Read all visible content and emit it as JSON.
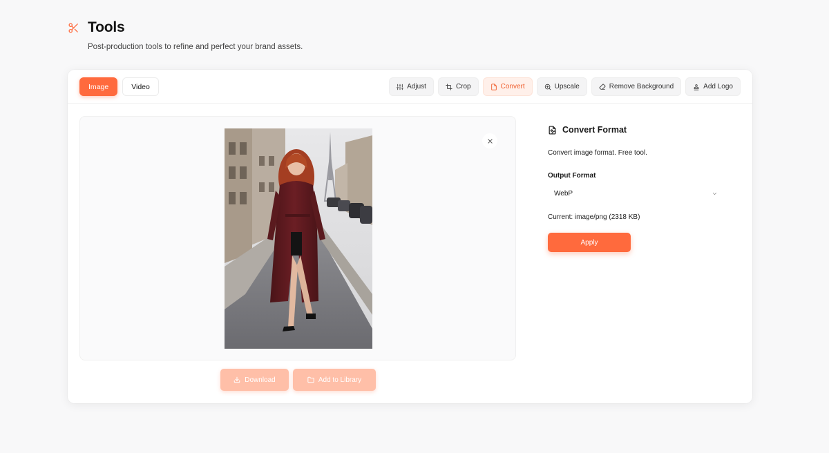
{
  "header": {
    "title": "Tools",
    "subtitle": "Post-production tools to refine and perfect your brand assets.",
    "icon": "scissors-icon"
  },
  "mode_tabs": [
    {
      "label": "Image",
      "active": true
    },
    {
      "label": "Video",
      "active": false
    }
  ],
  "tools": [
    {
      "label": "Adjust",
      "icon": "sliders-icon",
      "active": false
    },
    {
      "label": "Crop",
      "icon": "crop-icon",
      "active": false
    },
    {
      "label": "Convert",
      "icon": "file-icon",
      "active": true
    },
    {
      "label": "Upscale",
      "icon": "zoom-in-icon",
      "active": false
    },
    {
      "label": "Remove Background",
      "icon": "eraser-icon",
      "active": false
    },
    {
      "label": "Add Logo",
      "icon": "stamp-icon",
      "active": false
    }
  ],
  "preview": {
    "close_icon": "close-icon",
    "download_label": "Download",
    "library_label": "Add to Library"
  },
  "panel": {
    "title": "Convert Format",
    "description": "Convert image format. Free tool.",
    "output_label": "Output Format",
    "output_value": "WebP",
    "current": "Current: image/png (2318 KB)",
    "apply_label": "Apply"
  },
  "colors": {
    "accent": "#ff6a3d",
    "accent_soft": "#ffbfa8",
    "active_tool_bg": "#fff0ea"
  }
}
